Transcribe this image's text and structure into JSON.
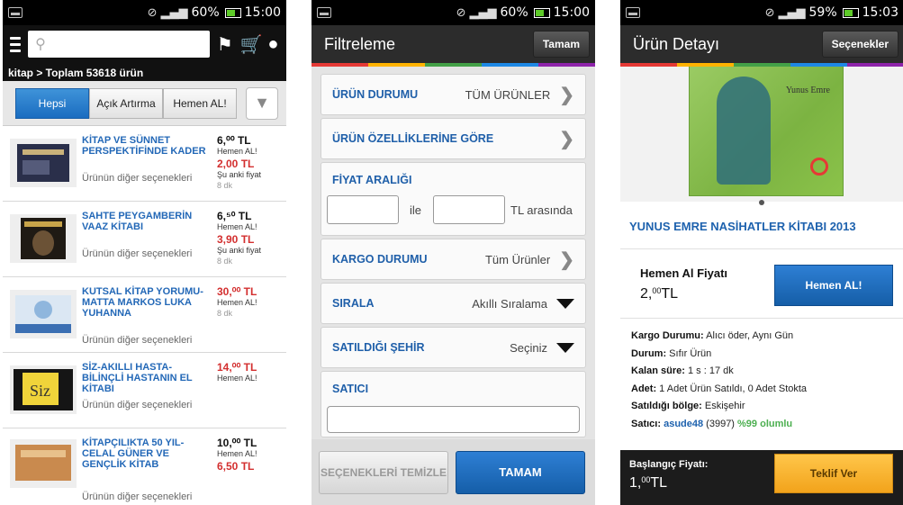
{
  "status_bar": {
    "p1": {
      "battery": "60%",
      "time": "15:00"
    },
    "p2": {
      "battery": "60%",
      "time": "15:00"
    },
    "p3": {
      "battery": "59%",
      "time": "15:03"
    }
  },
  "list_screen": {
    "search_placeholder": "",
    "breadcrumb": "kitap > Toplam 53618 ürün",
    "tabs": [
      {
        "label": "Hepsi",
        "active": true
      },
      {
        "label": "Açık Artırma",
        "active": false
      },
      {
        "label": "Hemen AL!",
        "active": false
      }
    ],
    "products": [
      {
        "title": "KİTAP VE SÜNNET PERSPEKTİFİNDE KADER",
        "sub": "Ürünün diğer seçenekleri",
        "price1": "6,⁰⁰ TL",
        "price1_red": false,
        "tag": "Hemen AL!",
        "price2": "2,00 TL",
        "note": "Şu anki fiyat",
        "time": "8 dk"
      },
      {
        "title": "SAHTE PEYGAMBERİN VAAZ KİTABI",
        "sub": "Ürünün diğer seçenekleri",
        "price1": "6,⁵⁰ TL",
        "price1_red": false,
        "tag": "Hemen AL!",
        "price2": "3,90 TL",
        "note": "Şu anki fiyat",
        "time": "8 dk"
      },
      {
        "title": "KUTSAL KİTAP YORUMU-MATTA MARKOS LUKA YUHANNA",
        "sub": "Ürünün diğer seçenekleri",
        "price1": "30,⁰⁰ TL",
        "price1_red": true,
        "tag": "Hemen AL!",
        "price2": "",
        "note": "",
        "time": "8 dk"
      },
      {
        "title": "SİZ-AKILLI HASTA-BİLİNÇLİ HASTANIN EL KİTABI",
        "sub": "Ürünün diğer seçenekleri",
        "price1": "14,⁰⁰ TL",
        "price1_red": true,
        "tag": "Hemen AL!",
        "price2": "",
        "note": "",
        "time": ""
      },
      {
        "title": "KİTAPÇILIKTA 50 YIL-CELAL GÜNER VE GENÇLİK KİTAB",
        "sub": "Ürünün diğer seçenekleri",
        "price1": "10,⁰⁰ TL",
        "price1_red": false,
        "tag": "Hemen AL!",
        "price2": "6,50 TL",
        "note": "",
        "time": ""
      }
    ]
  },
  "filter_screen": {
    "title": "Filtreleme",
    "done_button": "Tamam",
    "rows": {
      "product_status": {
        "label": "ÜRÜN DURUMU",
        "value": "TÜM ÜRÜNLER"
      },
      "product_features": {
        "label": "ÜRÜN ÖZELLİKLERİNE GÖRE",
        "value": ""
      },
      "price_range": {
        "label": "FİYAT ARALIĞI",
        "between": "ile",
        "suffix": "TL arasında"
      },
      "shipping": {
        "label": "KARGO DURUMU",
        "value": "Tüm Ürünler"
      },
      "sort": {
        "label": "SIRALA",
        "value": "Akıllı Sıralama"
      },
      "city": {
        "label": "SATILDIĞI ŞEHİR",
        "value": "Seçiniz"
      },
      "seller": {
        "label": "SATICI"
      }
    },
    "clear_button": "SEÇENEKLERİ TEMİZLE",
    "ok_button": "TAMAM"
  },
  "detail_screen": {
    "title": "Ürün Detayı",
    "options_button": "Seçenekler",
    "book_author_on_cover": "Yunus Emre",
    "product_title": "YUNUS EMRE NASİHATLER KİTABI 2013",
    "buy_now_label": "Hemen Al Fiyatı",
    "buy_now_price_int": "2,",
    "buy_now_price_dec": "00",
    "buy_now_currency": "TL",
    "buy_button": "Hemen AL!",
    "info": {
      "shipping_k": "Kargo Durumu:",
      "shipping_v": "Alıcı öder, Aynı Gün",
      "status_k": "Durum:",
      "status_v": "Sıfır Ürün",
      "remaining_k": "Kalan süre:",
      "remaining_v": "1 s : 17 dk",
      "count_k": "Adet:",
      "count_v": "1 Adet Ürün Satıldı, 0 Adet Stokta",
      "region_k": "Satıldığı bölge:",
      "region_v": "Eskişehir",
      "seller_k": "Satıcı:",
      "seller_name": "asude48",
      "seller_count": "(3997)",
      "seller_rating": "%99 olumlu"
    },
    "start_price_label": "Başlangıç Fiyatı:",
    "start_price_int": "1,",
    "start_price_dec": "00",
    "start_price_currency": "TL",
    "offer_button": "Teklif Ver"
  },
  "colors": {
    "accent_blue": "#1f5fa9",
    "price_red": "#d32f2f",
    "offer_orange": "#f2a31b"
  }
}
